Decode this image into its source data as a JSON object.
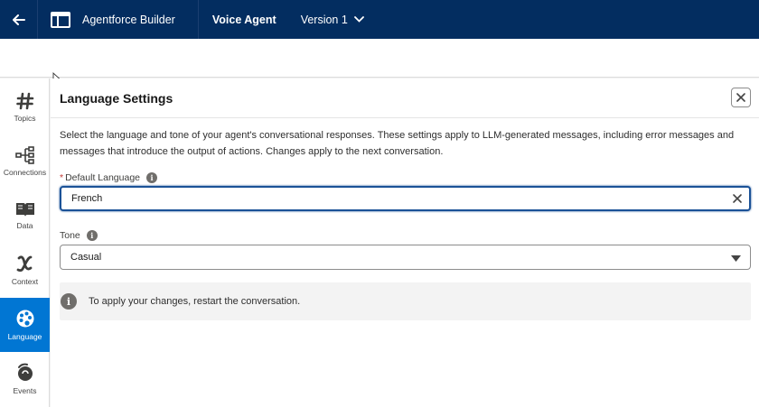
{
  "topbar": {
    "app_name": "Agentforce Builder",
    "agent_name": "Voice Agent",
    "version_label": "Version 1"
  },
  "rail": {
    "items": [
      {
        "label": "Topics",
        "icon": "hash-icon"
      },
      {
        "label": "Connections",
        "icon": "connections-icon"
      },
      {
        "label": "Data",
        "icon": "book-icon"
      },
      {
        "label": "Context",
        "icon": "variable-x-icon"
      },
      {
        "label": "Language",
        "icon": "palette-icon",
        "active": true
      },
      {
        "label": "Events",
        "icon": "events-icon"
      }
    ]
  },
  "panel": {
    "title": "Language Settings",
    "description": "Select the language and tone of your agent's conversational responses. These settings apply to LLM-generated messages, including error messages and messages that introduce the output of actions. Changes apply to the next conversation.",
    "default_language": {
      "required_mark": "*",
      "label": "Default Language",
      "value": "French"
    },
    "tone": {
      "label": "Tone",
      "value": "Casual"
    },
    "notice": "To apply your changes, restart the conversation."
  },
  "colors": {
    "header_bg": "#032d60",
    "active_rail": "#0176d3",
    "focus_border": "#1b5297"
  }
}
